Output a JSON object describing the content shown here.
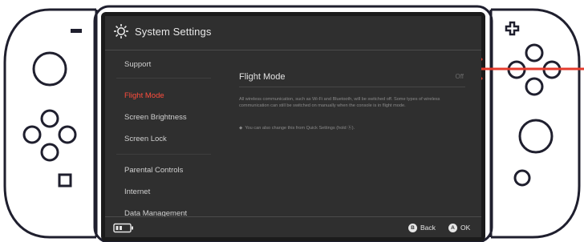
{
  "header": {
    "title": "System Settings",
    "icon": "gear-icon"
  },
  "sidebar": {
    "items": [
      {
        "label": "Support"
      },
      {
        "label": "Flight Mode",
        "selected": true
      },
      {
        "label": "Screen Brightness"
      },
      {
        "label": "Screen Lock"
      },
      {
        "label": "Parental Controls"
      },
      {
        "label": "Internet"
      },
      {
        "label": "Data Management"
      }
    ]
  },
  "setting": {
    "label": "Flight Mode",
    "value": "Off",
    "description": "All wireless communication, such as Wi-Fi and Bluetooth, will be switched off. Some types of wireless communication can still be switched on manually when the console is in flight mode.",
    "note": "You can also change this from Quick Settings (hold ⓗ)."
  },
  "footer": {
    "back_label": "Back",
    "back_button": "B",
    "ok_label": "OK",
    "ok_button": "A",
    "battery_icon": "battery-icon"
  },
  "colors": {
    "screen_bg": "#2f2f2f",
    "accent_selected": "#ff4d3d",
    "annotation_arrow": "#e53b2c",
    "outline": "#1f1f2e"
  }
}
